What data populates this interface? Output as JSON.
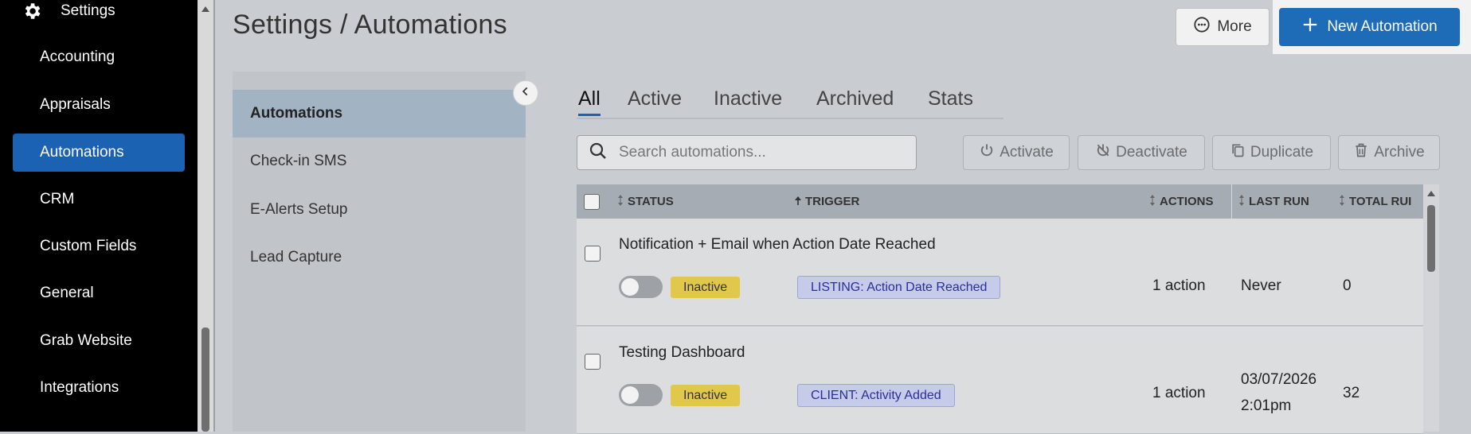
{
  "sidebar": {
    "settings_label": "Settings",
    "items": [
      {
        "label": "Accounting"
      },
      {
        "label": "Appraisals"
      },
      {
        "label": "Automations",
        "active": true
      },
      {
        "label": "CRM"
      },
      {
        "label": "Custom Fields"
      },
      {
        "label": "General"
      },
      {
        "label": "Grab Website"
      },
      {
        "label": "Integrations"
      }
    ]
  },
  "header": {
    "title": "Settings / Automations",
    "more_label": "More",
    "new_label": "New Automation"
  },
  "subnav": {
    "items": [
      {
        "label": "Automations",
        "active": true
      },
      {
        "label": "Check-in SMS"
      },
      {
        "label": "E-Alerts Setup"
      },
      {
        "label": "Lead Capture"
      }
    ]
  },
  "tabs": [
    {
      "label": "All",
      "active": true
    },
    {
      "label": "Active"
    },
    {
      "label": "Inactive"
    },
    {
      "label": "Archived"
    },
    {
      "label": "Stats"
    }
  ],
  "search": {
    "placeholder": "Search automations..."
  },
  "actions": {
    "activate": "Activate",
    "deactivate": "Deactivate",
    "duplicate": "Duplicate",
    "archive": "Archive"
  },
  "table": {
    "columns": {
      "status": "STATUS",
      "trigger": "TRIGGER",
      "actions": "ACTIONS",
      "last_run": "LAST RUN",
      "total_runs": "TOTAL RUI"
    },
    "rows": [
      {
        "name": "Notification + Email when Action Date Reached",
        "status": "Inactive",
        "trigger": "LISTING: Action Date Reached",
        "actions": "1 action",
        "last_run_line1": "Never",
        "last_run_line2": "",
        "total_runs": "0"
      },
      {
        "name": "Testing Dashboard",
        "status": "Inactive",
        "trigger": "CLIENT: Activity Added",
        "actions": "1 action",
        "last_run_line1": "03/07/2026",
        "last_run_line2": "2:01pm",
        "total_runs": "32"
      }
    ]
  },
  "colors": {
    "accent": "#1c62b3",
    "status_inactive": "#e2c84a",
    "trigger_badge": "#c5cbe8"
  },
  "icons": {
    "settings": "gear-icon",
    "more": "ellipsis-circle-icon",
    "new": "plus-icon",
    "collapse": "chevron-left-icon",
    "search": "search-icon",
    "activate": "power-icon",
    "deactivate": "power-off-icon",
    "duplicate": "copy-icon",
    "archive": "trash-icon"
  }
}
